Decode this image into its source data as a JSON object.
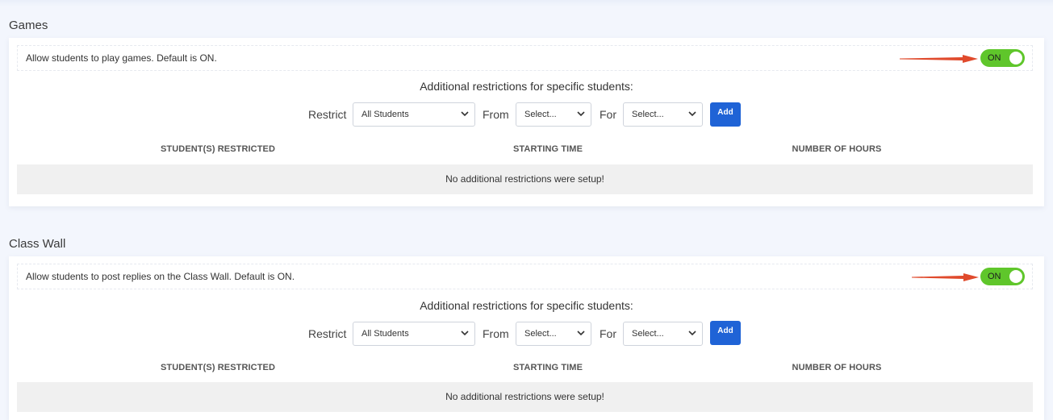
{
  "sections": [
    {
      "title": "Games",
      "setting_label": "Allow students to play games. Default is ON.",
      "toggle_label": "ON",
      "restrictions_heading": "Additional restrictions for specific students:",
      "restrict_label": "Restrict",
      "students_select_value": "All Students",
      "from_label": "From",
      "from_select_value": "Select...",
      "for_label": "For",
      "for_select_value": "Select...",
      "add_label": "Add",
      "columns": [
        "STUDENT(S) RESTRICTED",
        "STARTING TIME",
        "NUMBER OF HOURS"
      ],
      "empty_message": "No additional restrictions were setup!"
    },
    {
      "title": "Class Wall",
      "setting_label": "Allow students to post replies on the Class Wall. Default is ON.",
      "toggle_label": "ON",
      "restrictions_heading": "Additional restrictions for specific students:",
      "restrict_label": "Restrict",
      "students_select_value": "All Students",
      "from_label": "From",
      "from_select_value": "Select...",
      "for_label": "For",
      "for_select_value": "Select...",
      "add_label": "Add",
      "columns": [
        "STUDENT(S) RESTRICTED",
        "STARTING TIME",
        "NUMBER OF HOURS"
      ],
      "empty_message": "No additional restrictions were setup!"
    }
  ],
  "colors": {
    "toggle_on": "#5fc62b",
    "add_button": "#1f63d6",
    "annotation_arrow": "#e04a2c"
  },
  "icons": {
    "select_chevron": "chevron-down-icon",
    "annotation": "red-arrow-icon"
  }
}
